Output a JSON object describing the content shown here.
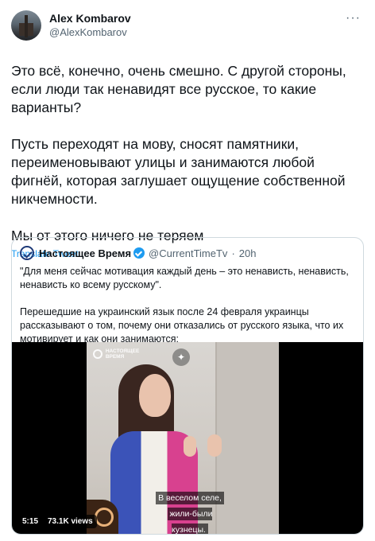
{
  "author": {
    "display_name": "Alex Kombarov",
    "handle": "@AlexKombarov"
  },
  "more_label": "···",
  "tweet": {
    "paragraphs": [
      "Это всё, конечно, очень смешно. С другой стороны, если люди так ненавидят все русское, то какие варианты?",
      "Пусть переходят на мову, сносят памятники, переименовывают улицы и занимаются любой фигнёй, которая заглушает ощущение собственной никчемности.",
      "Мы от этого ничего не теряем"
    ],
    "translate_label": "Translate Tweet"
  },
  "quoted": {
    "display_name": "Настоящее Время",
    "handle": "@CurrentTimeTv",
    "separator": "·",
    "time": "20h",
    "paragraphs": [
      "\"Для меня сейчас мотивация каждый день – это ненависть, ненависть, ненависть ко всему русскому\".",
      "Перешедшие на украинский язык после 24 февраля украинцы рассказывают о том, почему они отказались от русского языка, что их мотивирует и как они занимаются:"
    ],
    "video": {
      "watermark_line1": "НАСТОЯЩЕЕ",
      "watermark_line2": "ВРЕМЯ",
      "subtitle_line1": "В веселом селе,",
      "subtitle_line2": "жили-были кузнецы.",
      "duration": "5:15",
      "views": "73.1K views"
    }
  },
  "colors": {
    "link": "#1d9bf0",
    "secondary_text": "#536471",
    "border": "#cfd9de"
  }
}
